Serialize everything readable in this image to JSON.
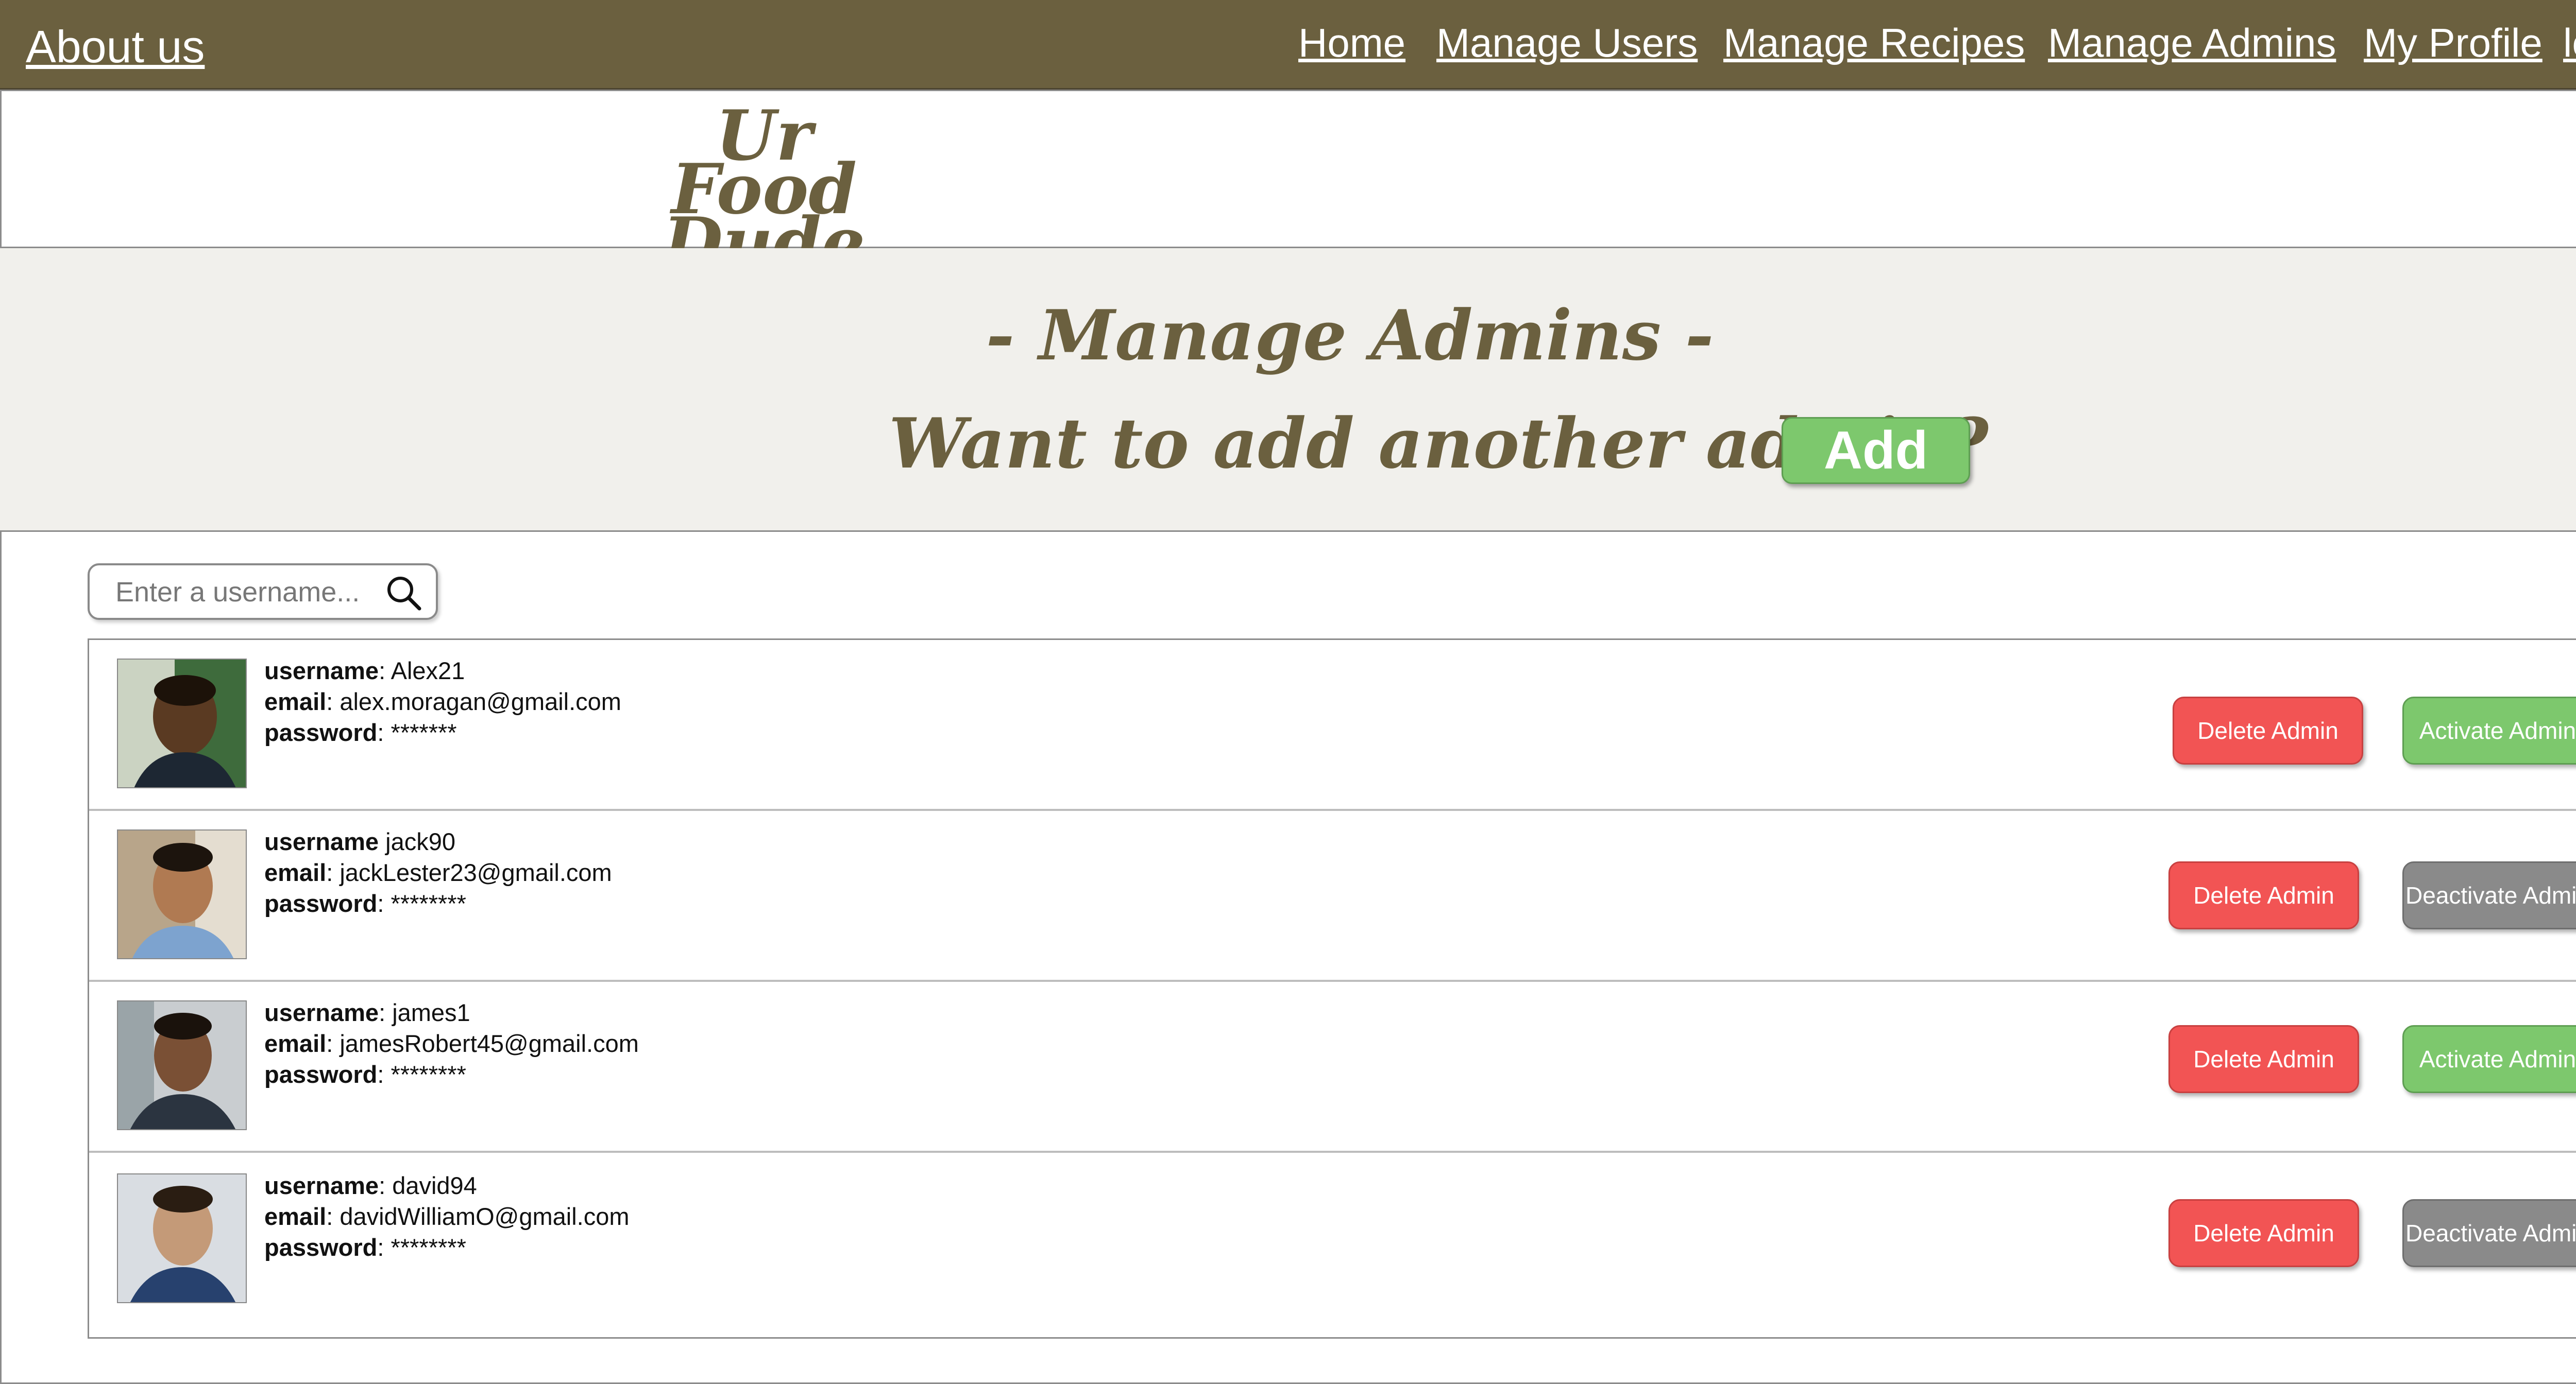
{
  "nav": {
    "about": "About us",
    "links": [
      "Home",
      "Manage Users",
      "Manage Recipes",
      "Manage Admins",
      "My Profile",
      "log out"
    ]
  },
  "logo": {
    "line1": "Ur",
    "line2": "Food Dude"
  },
  "hero": {
    "title": "- Manage Admins -",
    "question": "Want to add another admin?",
    "add_label": "Add"
  },
  "search": {
    "placeholder": "Enter a username..."
  },
  "labels": {
    "username": "username",
    "email": "email",
    "password": "password",
    "delete": "Delete Admin",
    "activate": "Activate Admin",
    "deactivate": "Deactivate Admin"
  },
  "admins": [
    {
      "username": "Alex21",
      "email": "alex.moragan@gmail.com",
      "password": "*******",
      "status_action": "Activate Admin"
    },
    {
      "username": "jack90",
      "email": "jackLester23@gmail.com",
      "password": "********",
      "status_action": "Deactivate Admin"
    },
    {
      "username": "james1",
      "email": "jamesRobert45@gmail.com",
      "password": "********",
      "status_action": "Activate Admin"
    },
    {
      "username": "david94",
      "email": "davidWilliamO@gmail.com",
      "password": "********",
      "status_action": "Deactivate Admin"
    }
  ],
  "colors": {
    "brand": "#6b603f",
    "hero_bg": "#f1f0ec",
    "delete": "#f25454",
    "activate": "#7dc86d",
    "deactivate": "#8a8a8a"
  }
}
